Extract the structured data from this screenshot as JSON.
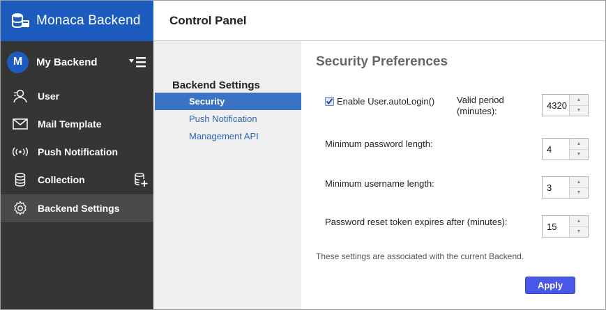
{
  "app": {
    "brand": "Monaca Backend",
    "logo_icon": "database-logo-icon"
  },
  "sidebar": {
    "backend": {
      "avatar_letter": "M",
      "name": "My Backend",
      "menu_icon": "menu-toggle-icon"
    },
    "items": [
      {
        "label": "User",
        "icon": "user-icon"
      },
      {
        "label": "Mail Template",
        "icon": "mail-icon"
      },
      {
        "label": "Push Notification",
        "icon": "broadcast-icon"
      },
      {
        "label": "Collection",
        "icon": "database-icon",
        "action_icon": "add-database-icon"
      },
      {
        "label": "Backend Settings",
        "icon": "gear-icon",
        "active": true
      }
    ]
  },
  "header": {
    "title": "Control Panel"
  },
  "subnav": {
    "title": "Backend Settings",
    "items": [
      {
        "label": "Security",
        "active": true
      },
      {
        "label": "Push Notification"
      },
      {
        "label": "Management API"
      }
    ]
  },
  "content": {
    "title": "Security Preferences",
    "auto_login": {
      "checkbox_label": "Enable User.autoLogin()",
      "checked": true,
      "valid_period_label_line1": "Valid period",
      "valid_period_label_line2": "(minutes):",
      "valid_period_value": "4320"
    },
    "min_password": {
      "label": "Minimum password length:",
      "value": "4"
    },
    "min_username": {
      "label": "Minimum username length:",
      "value": "3"
    },
    "reset_token": {
      "label": "Password reset token expires after (minutes):",
      "value": "15"
    },
    "note": "These settings are associated with the current Backend.",
    "apply_label": "Apply"
  },
  "colors": {
    "brand_blue": "#1c5cbf",
    "sidebar_bg": "#353535",
    "active_subnav": "#3a73c4",
    "apply_button": "#4a58ea"
  }
}
